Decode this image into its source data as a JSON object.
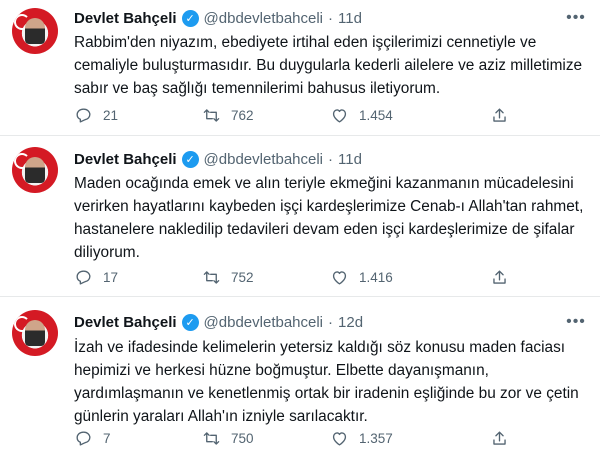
{
  "colors": {
    "accent": "#1d9bf0",
    "text": "#0f1419",
    "muted": "#536471",
    "divider": "#e7e9ea"
  },
  "tweets": [
    {
      "name": "Devlet Bahçeli",
      "handle": "@dbdevletbahceli",
      "dot": "·",
      "time": "11d",
      "text": "Rabbim'den niyazım, ebediyete irtihal eden işçilerimizi cennetiyle ve cemaliyle buluşturmasıdır. Bu duygularla kederli ailelere ve aziz milletimize sabır ve baş sağlığı temennilerimi bahusus iletiyorum.",
      "reply_count": "21",
      "retweet_count": "762",
      "like_count": "1.454"
    },
    {
      "name": "Devlet Bahçeli",
      "handle": "@dbdevletbahceli",
      "dot": "·",
      "time": "11d",
      "text": "Maden ocağında emek ve alın teriyle ekmeğini kazanmanın mücadelesini verirken hayatlarını kaybeden işçi kardeşlerimize Cenab-ı Allah'tan rahmet, hastanelere nakledilip tedavileri devam eden işçi kardeşlerimize de şifalar diliyorum.",
      "reply_count": "17",
      "retweet_count": "752",
      "like_count": "1.416"
    },
    {
      "name": "Devlet Bahçeli",
      "handle": "@dbdevletbahceli",
      "dot": "·",
      "time": "12d",
      "text": "İzah ve ifadesinde kelimelerin yetersiz kaldığı söz konusu maden faciası hepimizi ve herkesi hüzne boğmuştur. Elbette dayanışmanın, yardımlaşmanın ve kenetlenmiş ortak bir iradenin eşliğinde bu zor ve çetin günlerin yaraları Allah'ın izniyle sarılacaktır.",
      "reply_count": "7",
      "retweet_count": "750",
      "like_count": "1.357"
    }
  ]
}
